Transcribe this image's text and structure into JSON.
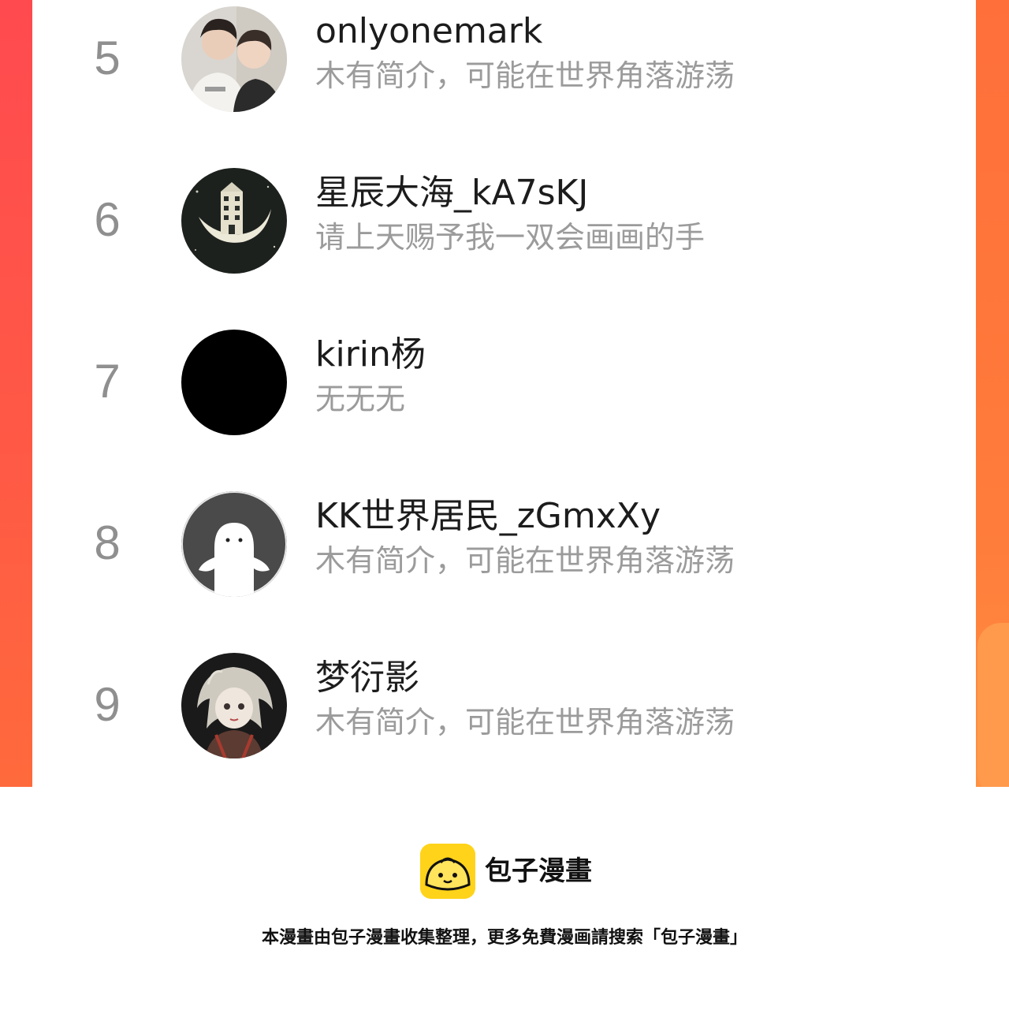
{
  "leaderboard": {
    "entries": [
      {
        "rank": "5",
        "name": "onlyonemark",
        "bio": "木有简介，可能在世界角落游荡",
        "avatar_icon": "two-people-photo-avatar"
      },
      {
        "rank": "6",
        "name": "星辰大海_kA7sKJ",
        "bio": "请上天赐予我一双会画画的手",
        "avatar_icon": "moon-house-avatar"
      },
      {
        "rank": "7",
        "name": "kirin杨",
        "bio": "无无无",
        "avatar_icon": "black-circle-avatar"
      },
      {
        "rank": "8",
        "name": "KK世界居民_zGmxXy",
        "bio": "木有简介，可能在世界角落游荡",
        "avatar_icon": "default-ghost-avatar"
      },
      {
        "rank": "9",
        "name": "梦衍影",
        "bio": "木有简介，可能在世界角落游荡",
        "avatar_icon": "anime-girl-avatar"
      }
    ]
  },
  "footer": {
    "brand_name": "包子漫畫",
    "brand_icon": "bun-mascot-icon",
    "note": "本漫畫由包子漫畫收集整理，更多免費漫画請搜索「包子漫畫」"
  },
  "colors": {
    "frame_left": "#ff4a4f",
    "frame_right": "#ff7d3b",
    "rank_text": "#8f8f8f",
    "name_text": "#1c1c1c",
    "bio_text": "#9b9b9b",
    "brand_yellow": "#ffd31a"
  }
}
